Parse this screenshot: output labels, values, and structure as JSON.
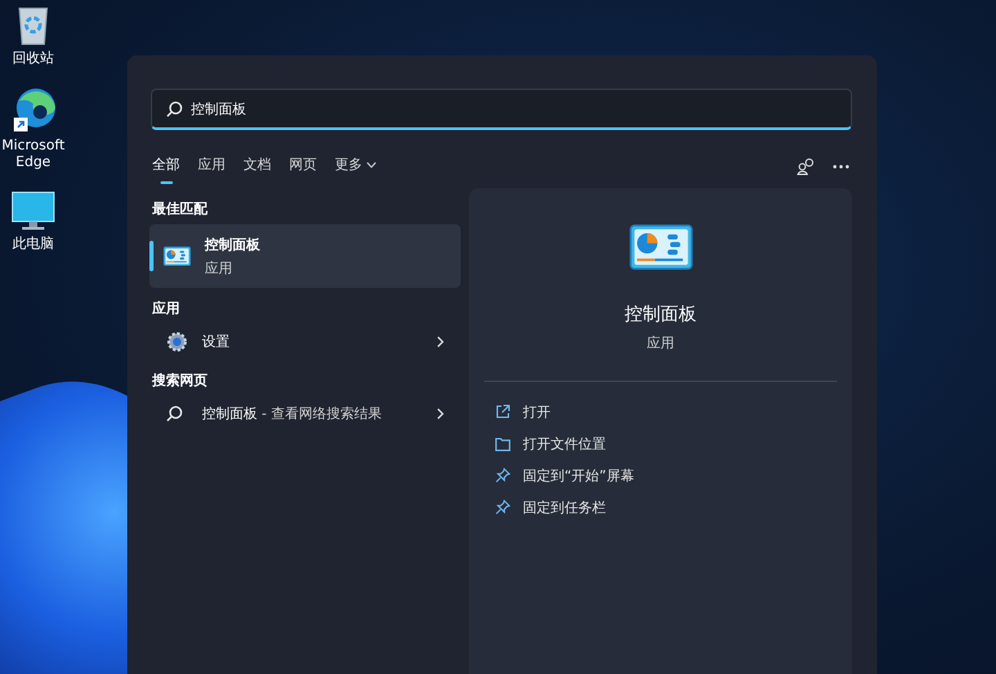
{
  "desktop_icons": [
    {
      "kind": "recycle",
      "label": "回收站"
    },
    {
      "kind": "edge",
      "label": "Microsoft Edge"
    },
    {
      "kind": "pc",
      "label": "此电脑"
    }
  ],
  "search": {
    "value": "控制面板"
  },
  "tabs": [
    {
      "label": "全部",
      "selected": true,
      "has_menu": false
    },
    {
      "label": "应用",
      "selected": false,
      "has_menu": false
    },
    {
      "label": "文档",
      "selected": false,
      "has_menu": false
    },
    {
      "label": "网页",
      "selected": false,
      "has_menu": false
    },
    {
      "label": "更多",
      "selected": false,
      "has_menu": true
    }
  ],
  "sections": [
    {
      "title": "最佳匹配",
      "items": [
        {
          "kind": "app",
          "title": "控制面板",
          "subtitle": "应用",
          "selected": true
        }
      ]
    },
    {
      "title": "应用",
      "items": [
        {
          "kind": "row",
          "title": "设置",
          "selected": false
        }
      ]
    },
    {
      "title": "搜索网页",
      "items": [
        {
          "kind": "row",
          "title": "控制面板",
          "suffix": " - 查看网络搜索结果",
          "selected": false
        }
      ]
    }
  ],
  "detail": {
    "title": "控制面板",
    "subtitle": "应用",
    "actions": [
      {
        "kind": "open",
        "label": "打开"
      },
      {
        "kind": "folder",
        "label": "打开文件位置"
      },
      {
        "kind": "pin",
        "label": "固定到“开始”屏幕"
      },
      {
        "kind": "pin",
        "label": "固定到任务栏"
      }
    ]
  }
}
